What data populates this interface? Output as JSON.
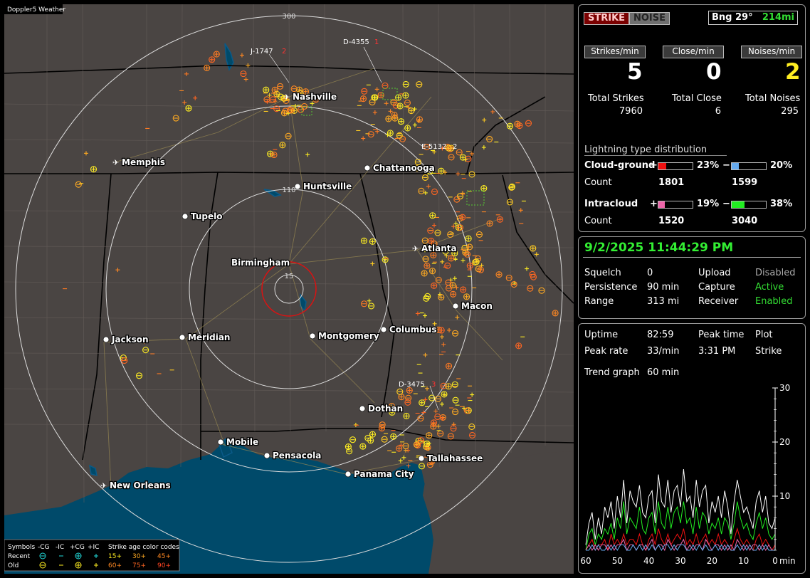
{
  "map": {
    "title": "Doppler5 Weather",
    "range_labels": [
      "300",
      "110",
      "15"
    ],
    "cities": [
      {
        "name": "Nashville",
        "marker": "airport"
      },
      {
        "name": "Memphis",
        "marker": "airport"
      },
      {
        "name": "Chattanooga",
        "marker": "dot"
      },
      {
        "name": "Huntsville",
        "marker": "dot"
      },
      {
        "name": "Tupelo",
        "marker": "dot"
      },
      {
        "name": "Atlanta",
        "marker": "airport"
      },
      {
        "name": "Birmingham",
        "marker": "dot"
      },
      {
        "name": "Macon",
        "marker": "dot"
      },
      {
        "name": "Jackson",
        "marker": "dot"
      },
      {
        "name": "Meridian",
        "marker": "dot"
      },
      {
        "name": "Montgomery",
        "marker": "dot"
      },
      {
        "name": "Columbus",
        "marker": "dot"
      },
      {
        "name": "Dothan",
        "marker": "dot"
      },
      {
        "name": "Mobile",
        "marker": "dot"
      },
      {
        "name": "Pensacola",
        "marker": "dot"
      },
      {
        "name": "Panama City",
        "marker": "dot"
      },
      {
        "name": "Tallahassee",
        "marker": "dot"
      },
      {
        "name": "New Orleans",
        "marker": "airport"
      }
    ],
    "station_ids": [
      {
        "id": "J-1747",
        "n": "2"
      },
      {
        "id": "D-4355",
        "n": "1"
      },
      {
        "id": "E-5132",
        "n": "2"
      },
      {
        "id": "D-3475",
        "n": "3"
      }
    ],
    "legend": {
      "symbols_label": "Symbols",
      "columns": [
        "-CG",
        "-IC",
        "+CG",
        "+IC"
      ],
      "rows": [
        "Recent",
        "Old"
      ],
      "age_title": "Strike age color codes",
      "age_recent": [
        "15+",
        "30+",
        "45+"
      ],
      "age_old": [
        "60+",
        "75+",
        "90+"
      ]
    },
    "colors": {
      "land": "#4a4543",
      "water": "#004a6a",
      "rings": "#dddddd",
      "center_ring": "#dd1111",
      "strike_yellow": "#ffee22",
      "strike_orange": "#ff7a22"
    }
  },
  "panel1": {
    "strike_button": "STRIKE",
    "noise_button": "NOISE",
    "bearing": "Bng 29°",
    "distance": "214mi",
    "headers": [
      "Strikes/min",
      "Close/min",
      "Noises/min"
    ],
    "rates": [
      "5",
      "0",
      "2"
    ],
    "totals_labels": [
      "Total Strikes",
      "Total Close",
      "Total Noises"
    ],
    "totals_values": [
      "7960",
      "6",
      "295"
    ],
    "distribution_title": "Lightning type distribution",
    "cg_label": "Cloud-ground",
    "ic_label": "Intracloud",
    "plus": "+",
    "minus": "−",
    "count_label": "Count",
    "cg_pos_pct": "23%",
    "cg_neg_pct": "20%",
    "ic_pos_pct": "19%",
    "ic_neg_pct": "38%",
    "cg_pos_count": "1801",
    "cg_neg_count": "1599",
    "ic_pos_count": "1520",
    "ic_neg_count": "3040",
    "cg_pos_fill": 0.23,
    "cg_neg_fill": 0.2,
    "ic_pos_fill": 0.19,
    "ic_neg_fill": 0.38,
    "cg_pos_color": "#ee1111",
    "cg_neg_color": "#66aaee",
    "ic_pos_color": "#ee66aa",
    "ic_neg_color": "#22ee22"
  },
  "panel2": {
    "datetime": "9/2/2025 11:44:29 PM",
    "rows": [
      {
        "k1": "Squelch",
        "v1": "0",
        "k2": "Upload",
        "v2": "Disabled"
      },
      {
        "k1": "Persistence",
        "v1": "90 min",
        "k2": "Capture",
        "v2": "Active"
      },
      {
        "k1": "Range",
        "v1": "313 mi",
        "k2": "Receiver",
        "v2": "Enabled"
      }
    ]
  },
  "panel3": {
    "uptime_label": "Uptime",
    "uptime": "82:59",
    "peak_time_label": "Peak time",
    "plot_label": "Plot",
    "peak_rate_label": "Peak rate",
    "peak_rate": "33/min",
    "peak_time": "3:31 PM",
    "plot_value": "Strike",
    "trend_label": "Trend graph",
    "trend_value": "60 min"
  },
  "chart_data": {
    "type": "line",
    "title": "",
    "xlabel": "min",
    "ylabel": "",
    "x_ticks": [
      "60",
      "50",
      "40",
      "30",
      "20",
      "10",
      "0"
    ],
    "y_ticks": [
      "30",
      "20",
      "10"
    ],
    "xlim": [
      60,
      0
    ],
    "ylim": [
      0,
      30
    ],
    "series": [
      {
        "color": "#ffffff",
        "values": [
          1,
          5,
          7,
          2,
          6,
          3,
          8,
          6,
          9,
          4,
          10,
          6,
          13,
          5,
          11,
          9,
          8,
          12,
          7,
          6,
          10,
          11,
          5,
          14,
          9,
          8,
          13,
          7,
          11,
          12,
          8,
          15,
          9,
          10,
          6,
          13,
          8,
          11,
          12,
          5,
          9,
          7,
          10,
          6,
          11,
          8,
          3,
          9,
          13,
          10,
          7,
          8,
          6,
          4,
          9,
          11,
          7,
          10,
          5,
          4,
          6
        ]
      },
      {
        "color": "#22ee22",
        "values": [
          0,
          3,
          4,
          1,
          3,
          2,
          4,
          3,
          5,
          2,
          6,
          4,
          9,
          3,
          6,
          5,
          4,
          8,
          4,
          3,
          6,
          7,
          3,
          9,
          5,
          4,
          8,
          4,
          7,
          8,
          5,
          9,
          5,
          6,
          3,
          8,
          4,
          7,
          6,
          3,
          5,
          4,
          6,
          3,
          6,
          5,
          2,
          5,
          9,
          6,
          4,
          5,
          3,
          2,
          5,
          7,
          4,
          6,
          3,
          2,
          3
        ]
      },
      {
        "color": "#ee1111",
        "values": [
          0,
          1,
          2,
          0,
          1,
          1,
          2,
          0,
          3,
          1,
          2,
          1,
          3,
          1,
          2,
          2,
          1,
          3,
          1,
          0,
          2,
          3,
          1,
          4,
          2,
          1,
          3,
          1,
          2,
          3,
          2,
          4,
          1,
          2,
          1,
          3,
          1,
          2,
          3,
          1,
          2,
          1,
          3,
          1,
          2,
          1,
          0,
          2,
          4,
          2,
          1,
          2,
          1,
          0,
          2,
          3,
          1,
          2,
          1,
          0,
          1
        ]
      },
      {
        "color": "#ee66aa",
        "values": [
          0,
          1,
          0,
          1,
          0,
          1,
          1,
          0,
          1,
          0,
          1,
          1,
          2,
          0,
          1,
          1,
          0,
          1,
          1,
          0,
          1,
          2,
          0,
          1,
          1,
          0,
          2,
          1,
          0,
          1,
          1,
          2,
          0,
          1,
          0,
          1,
          1,
          0,
          2,
          1,
          0,
          1,
          1,
          0,
          1,
          0,
          1,
          0,
          2,
          1,
          0,
          1,
          0,
          1,
          1,
          0,
          1,
          0,
          1,
          0,
          0
        ]
      },
      {
        "color": "#66aaee",
        "values": [
          0,
          0,
          1,
          0,
          1,
          0,
          0,
          1,
          0,
          1,
          0,
          1,
          1,
          0,
          0,
          1,
          0,
          1,
          0,
          1,
          0,
          1,
          0,
          1,
          0,
          1,
          1,
          0,
          1,
          0,
          1,
          1,
          0,
          0,
          1,
          0,
          1,
          0,
          1,
          0,
          0,
          1,
          0,
          1,
          0,
          1,
          0,
          0,
          1,
          0,
          1,
          0,
          1,
          0,
          0,
          1,
          0,
          1,
          0,
          0,
          0
        ]
      }
    ]
  }
}
